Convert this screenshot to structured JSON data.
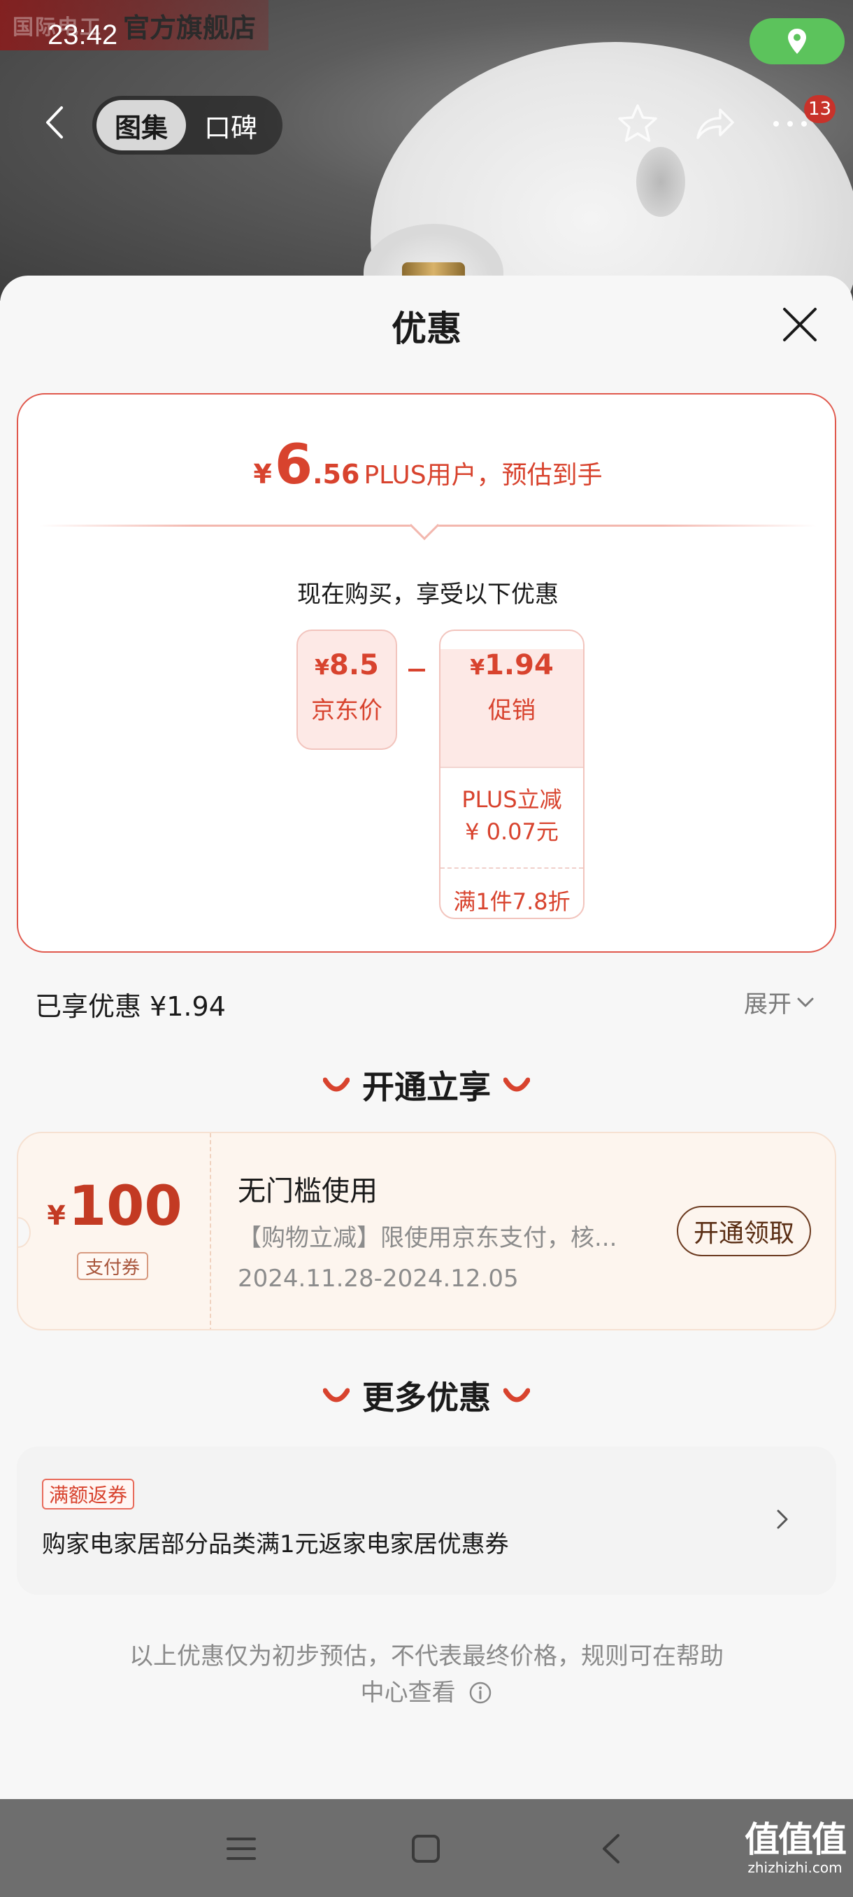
{
  "status_bar": {
    "time": "23:42"
  },
  "header": {
    "brand_faded": "国际电工",
    "store_name": "官方旗舰店",
    "tabs": [
      {
        "label": "图集",
        "active": true
      },
      {
        "label": "口碑",
        "active": false
      }
    ],
    "more_badge": "13",
    "icons": [
      "back-icon",
      "star-icon",
      "share-icon",
      "more-icon",
      "location-icon"
    ]
  },
  "sheet": {
    "title": "优惠",
    "estimate": {
      "currency": "¥",
      "int": "6",
      "dec": ".56",
      "text": "PLUS用户，预估到手"
    },
    "subtitle": "现在购买，享受以下优惠",
    "jd_price": {
      "currency": "¥",
      "amount": "8.5",
      "label": "京东价"
    },
    "promo": {
      "currency": "¥",
      "amount": "1.94",
      "label": "促销",
      "items": [
        {
          "line1": "PLUS立减",
          "line2": "¥ 0.07元"
        },
        {
          "line1": "满1件7.8折"
        }
      ]
    },
    "enjoyed": "已享优惠 ¥1.94",
    "expand": "展开",
    "section_open": "开通立享",
    "coupon": {
      "currency": "¥",
      "amount": "100",
      "tag": "支付券",
      "title": "无门槛使用",
      "desc": "【购物立减】限使用京东支付，核...",
      "date": "2024.11.28-2024.12.05",
      "button": "开通领取"
    },
    "section_more": "更多优惠",
    "more": {
      "tag": "满额返券",
      "text": "购家电家居部分品类满1元返家电家居优惠券"
    },
    "disclaimer_line1": "以上优惠仅为初步预估，不代表最终价格，规则可在帮助",
    "disclaimer_line2": "中心查看"
  },
  "watermark": {
    "big": "值值值",
    "small": "zhizhizhi.com"
  },
  "colors": {
    "accent": "#d8432e",
    "coupon_bg": "#fdf5ee",
    "location": "#5cc35c"
  }
}
